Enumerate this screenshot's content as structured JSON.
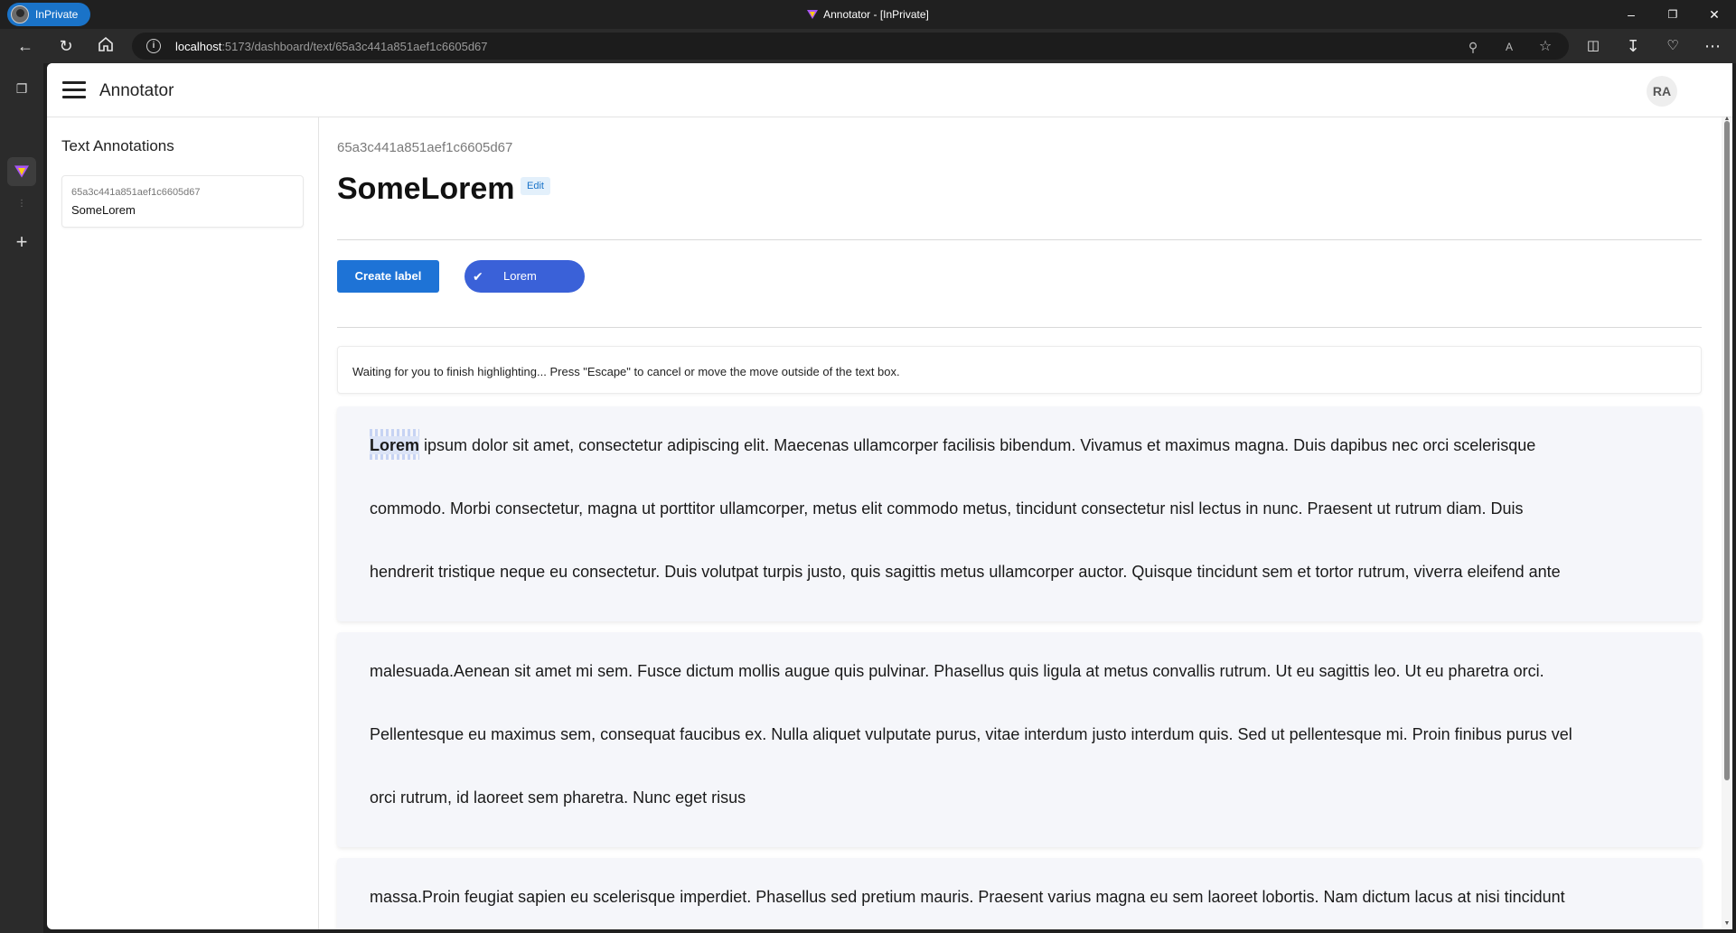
{
  "browser": {
    "inprivate_label": "InPrivate",
    "window_title": "Annotator - [InPrivate]",
    "url_host": "localhost",
    "url_rest": ":5173/dashboard/text/65a3c441a851aef1c6605d67"
  },
  "app": {
    "title": "Annotator",
    "user_initials": "RA"
  },
  "sidebar": {
    "heading": "Text Annotations",
    "items": [
      {
        "id": "65a3c441a851aef1c6605d67",
        "name": "SomeLorem"
      }
    ]
  },
  "document": {
    "id": "65a3c441a851aef1c6605d67",
    "title": "SomeLorem",
    "edit_label": "Edit"
  },
  "toolbar": {
    "create_label": "Create label",
    "labels": [
      {
        "name": "Lorem",
        "selected": true
      }
    ]
  },
  "status_message": "Waiting for you to finish highlighting... Press \"Escape\" to cancel or move the move outside of the text box.",
  "text_blocks": [
    {
      "highlight": "Lorem",
      "lines": [
        " ipsum dolor sit amet, consectetur adipiscing elit. Maecenas ullamcorper facilisis bibendum. Vivamus et maximus magna. Duis dapibus nec orci scelerisque",
        "commodo. Morbi consectetur, magna ut porttitor ullamcorper, metus elit commodo metus, tincidunt consectetur nisl lectus in nunc. Praesent ut rutrum diam. Duis",
        "hendrerit tristique neque eu consectetur. Duis volutpat turpis justo, quis sagittis metus ullamcorper auctor. Quisque tincidunt sem et tortor rutrum, viverra eleifend ante"
      ]
    },
    {
      "lines": [
        "malesuada.Aenean sit amet mi sem. Fusce dictum mollis augue quis pulvinar. Phasellus quis ligula at metus convallis rutrum. Ut eu sagittis leo. Ut eu pharetra orci.",
        "Pellentesque eu maximus sem, consequat faucibus ex. Nulla aliquet vulputate purus, vitae interdum justo interdum quis. Sed ut pellentesque mi. Proin finibus purus vel",
        "orci rutrum, id laoreet sem pharetra. Nunc eget risus"
      ]
    },
    {
      "lines": [
        "massa.Proin feugiat sapien eu scelerisque imperdiet. Phasellus sed pretium mauris. Praesent varius magna eu sem laoreet lobortis. Nam dictum lacus at nisi tincidunt"
      ]
    }
  ],
  "icons": {
    "back": "arrow-left-icon",
    "refresh": "refresh-icon",
    "home": "home-icon",
    "info": "info-icon",
    "menu": "hamburger-icon",
    "check": "check-icon"
  },
  "colors": {
    "primary": "#1e73d6",
    "label_chip": "#3a61d8",
    "text_block_bg": "#f5f6fa",
    "highlight": "#dce4f7"
  }
}
